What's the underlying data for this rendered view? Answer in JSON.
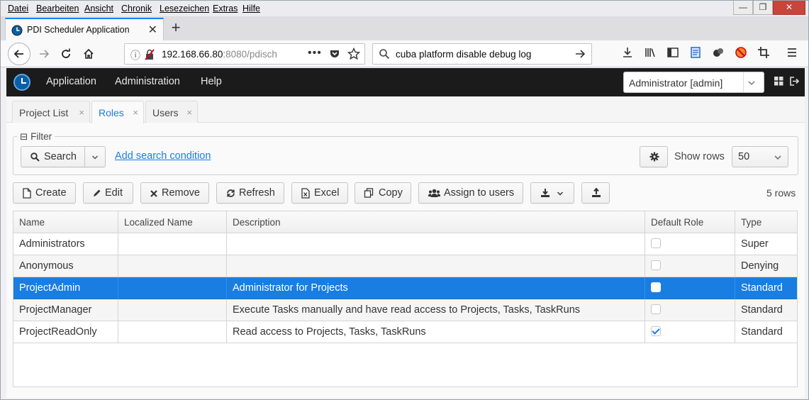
{
  "browser": {
    "menu": [
      "Datei",
      "Bearbeiten",
      "Ansicht",
      "Chronik",
      "Lesezeichen",
      "Extras",
      "Hilfe"
    ],
    "window_controls": [
      "—",
      "❐",
      "✕"
    ],
    "tab_title": "PDI Scheduler Application",
    "tab_close": "✕",
    "new_tab": "+",
    "url_main": "192.168.66.80",
    "url_rest": ":8080/pdisch",
    "url_more": "•••",
    "search_text": "cuba platform disable debug log"
  },
  "app": {
    "menu": [
      "Application",
      "Administration",
      "Help"
    ],
    "user": "Administrator [admin]",
    "tabs": [
      {
        "label": "Project List",
        "close": "×"
      },
      {
        "label": "Roles",
        "close": "×"
      },
      {
        "label": "Users",
        "close": "×"
      }
    ],
    "filter": {
      "caption": "Filter",
      "collapse_glyph": "⊟",
      "search_label": "Search",
      "add_condition": "Add search condition",
      "show_rows_label": "Show rows",
      "show_rows_value": "50"
    },
    "actions": {
      "create": "Create",
      "edit": "Edit",
      "remove": "Remove",
      "refresh": "Refresh",
      "excel": "Excel",
      "copy": "Copy",
      "assign": "Assign to users"
    },
    "row_count": "5 rows",
    "table": {
      "columns": [
        "Name",
        "Localized Name",
        "Description",
        "Default Role",
        "Type"
      ],
      "rows": [
        {
          "name": "Administrators",
          "localized": "",
          "description": "",
          "default_role": false,
          "type": "Super",
          "selected": false
        },
        {
          "name": "Anonymous",
          "localized": "",
          "description": "",
          "default_role": false,
          "type": "Denying",
          "selected": false
        },
        {
          "name": "ProjectAdmin",
          "localized": "",
          "description": "Administrator for Projects",
          "default_role": false,
          "type": "Standard",
          "selected": true
        },
        {
          "name": "ProjectManager",
          "localized": "",
          "description": "Execute Tasks manually and have read access to Projects, Tasks, TaskRuns",
          "default_role": false,
          "type": "Standard",
          "selected": false
        },
        {
          "name": "ProjectReadOnly",
          "localized": "",
          "description": "Read access to Projects, Tasks, TaskRuns",
          "default_role": true,
          "type": "Standard",
          "selected": false
        }
      ]
    }
  },
  "colors": {
    "accent": "#197de1",
    "header_bg": "#1b1b1b",
    "firefox_blue": "#0a84ff"
  }
}
